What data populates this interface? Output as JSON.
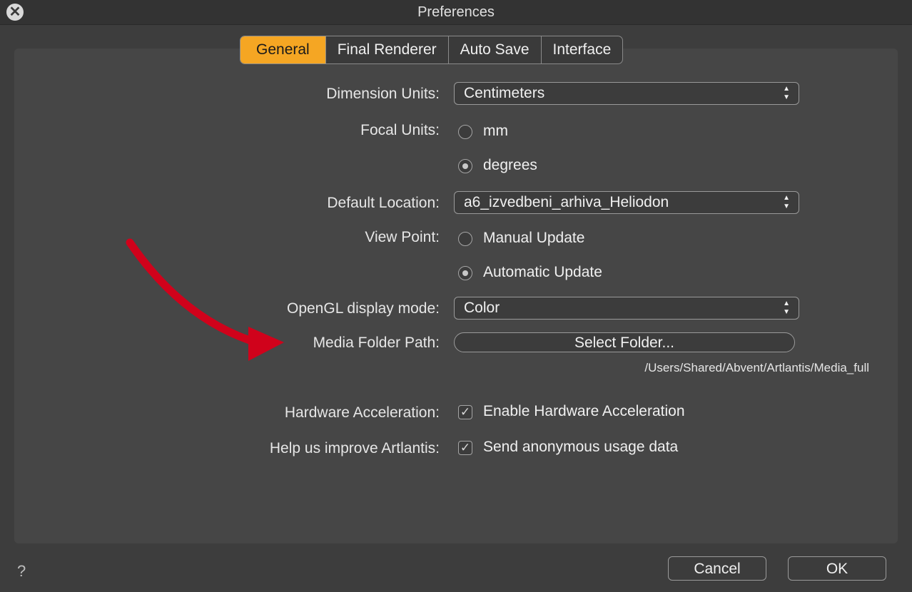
{
  "window": {
    "title": "Preferences"
  },
  "tabs": [
    {
      "label": "General",
      "active": true
    },
    {
      "label": "Final Renderer",
      "active": false
    },
    {
      "label": "Auto Save",
      "active": false
    },
    {
      "label": "Interface",
      "active": false
    }
  ],
  "general": {
    "dimension_units": {
      "label": "Dimension Units:",
      "value": "Centimeters"
    },
    "focal_units": {
      "label": "Focal Units:",
      "options": [
        {
          "label": "mm",
          "selected": false
        },
        {
          "label": "degrees",
          "selected": true
        }
      ]
    },
    "default_location": {
      "label": "Default Location:",
      "value": "a6_izvedbeni_arhiva_Heliodon"
    },
    "view_point": {
      "label": "View Point:",
      "options": [
        {
          "label": "Manual Update",
          "selected": false
        },
        {
          "label": "Automatic Update",
          "selected": true
        }
      ]
    },
    "opengl_mode": {
      "label": "OpenGL display mode:",
      "value": "Color"
    },
    "media_folder": {
      "label": "Media Folder Path:",
      "button_label": "Select Folder...",
      "path": "/Users/Shared/Abvent/Artlantis/Media_full"
    },
    "hardware_acceleration": {
      "label": "Hardware Acceleration:",
      "checkbox_label": "Enable Hardware Acceleration",
      "checked": true
    },
    "improve": {
      "label": "Help us improve Artlantis:",
      "checkbox_label": "Send anonymous usage data",
      "checked": true
    }
  },
  "footer": {
    "help_label": "?",
    "cancel_label": "Cancel",
    "ok_label": "OK"
  },
  "colors": {
    "accent": "#f5a623",
    "annotation_arrow": "#d0021b"
  }
}
